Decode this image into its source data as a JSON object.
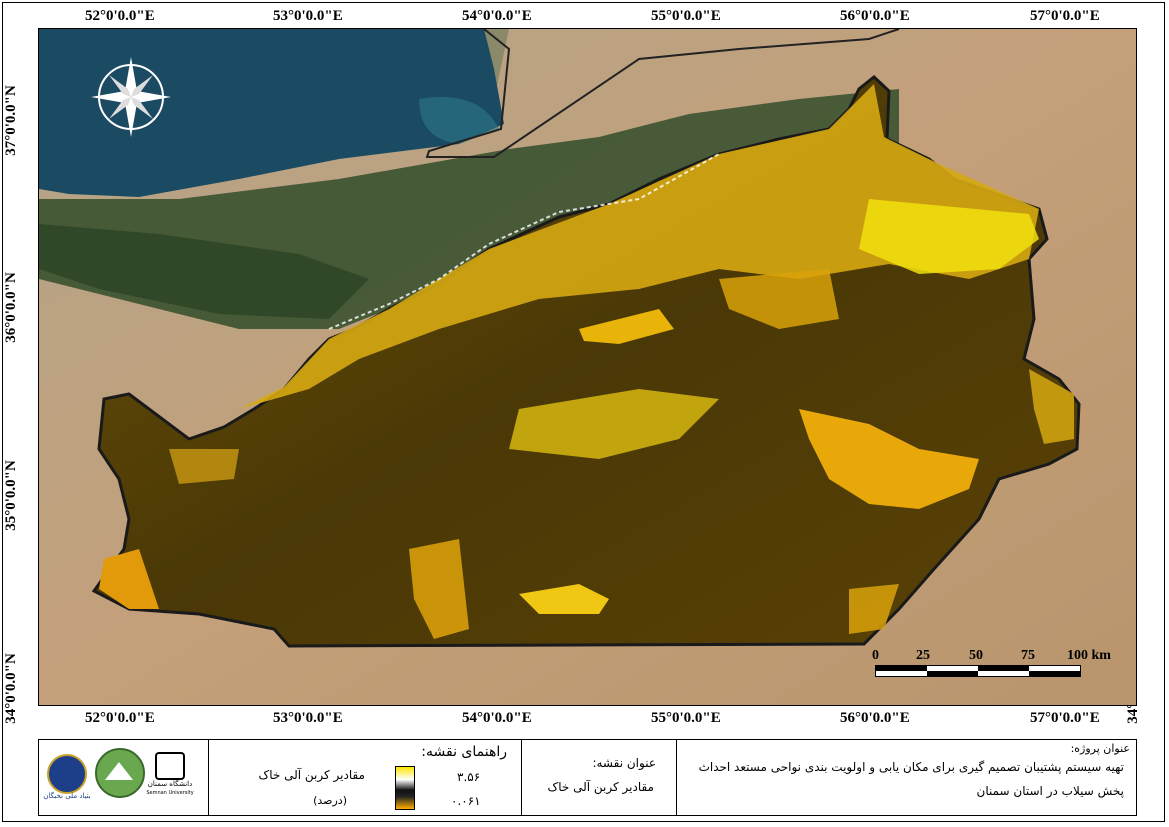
{
  "lon_ticks": [
    "52°0'0.0\"E",
    "53°0'0.0\"E",
    "54°0'0.0\"E",
    "55°0'0.0\"E",
    "56°0'0.0\"E",
    "57°0'0.0\"E"
  ],
  "lat_ticks": [
    "37°0'0.0\"N",
    "36°0'0.0\"N",
    "35°0'0.0\"N",
    "34°0'0.0\"N"
  ],
  "scale_bar": {
    "labels": [
      "0",
      "25",
      "50",
      "75",
      "100 km"
    ]
  },
  "legend": {
    "heading": "راهنمای نقشه:",
    "item_label": "مقادیر کربن آلی خاک",
    "item_unit": "(درصد)",
    "max_value": "۳.۵۶",
    "min_value": "۰.۰۶۱",
    "ramp_colors": [
      "#ffe600",
      "#ffffff",
      "#111111",
      "#ffb000"
    ]
  },
  "map_title": {
    "heading": "عنوان نقشه:",
    "text": "مقادیر کربن آلی خاک"
  },
  "project": {
    "heading": "عنوان پروژه:",
    "line1": "تهیه سیستم پشتیبان تصمیم گیری برای مکان یابی و اولویت بندی نواحی مستعد احداث",
    "line2": "پخش سیلاب در استان سمنان"
  },
  "logos": {
    "logo1_text": "بنیاد ملی نخبگان",
    "logo3_text": "دانشگاه سمنان",
    "logo3_sub": "Semnan University"
  },
  "colors": {
    "sea": "#1b4a63",
    "forest": "#2f4a2a",
    "desert": "#b89a78",
    "dark_soil": "#4a3a08",
    "gold": "#e8b40a",
    "yellow": "#f2e10e"
  }
}
